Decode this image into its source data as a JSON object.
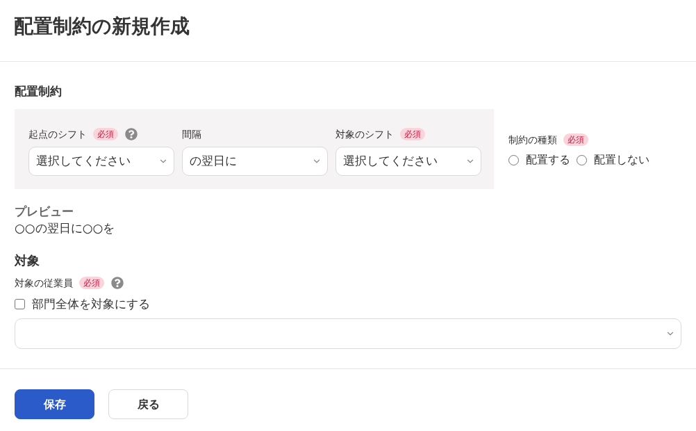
{
  "page": {
    "title": "配置制約の新規作成"
  },
  "constraint_section": {
    "heading": "配置制約",
    "fields": [
      {
        "kind": "select",
        "label": "起点のシフト",
        "required_badge": "必須",
        "help": true,
        "value": "選択してください"
      },
      {
        "kind": "select",
        "label": "間隔",
        "value": "の翌日に"
      },
      {
        "kind": "select",
        "label": "対象のシフト",
        "required_badge": "必須",
        "value": "選択してください"
      }
    ],
    "constraint_type": {
      "label": "制約の種類",
      "required_badge": "必須",
      "options": [
        {
          "label": "配置する",
          "selected": false
        },
        {
          "label": "配置しない",
          "selected": false
        }
      ]
    }
  },
  "preview": {
    "heading": "プレビュー",
    "text": "○○の翌日に○○を"
  },
  "target_section": {
    "heading": "対象",
    "employees": {
      "label": "対象の従業員",
      "required_badge": "必須",
      "help": true,
      "checkbox": {
        "label": "部門全体を対象にする",
        "checked": false
      }
    }
  },
  "buttons": [
    {
      "label": "保存",
      "kind": "primary"
    },
    {
      "label": "戻る",
      "kind": "secondary"
    }
  ]
}
